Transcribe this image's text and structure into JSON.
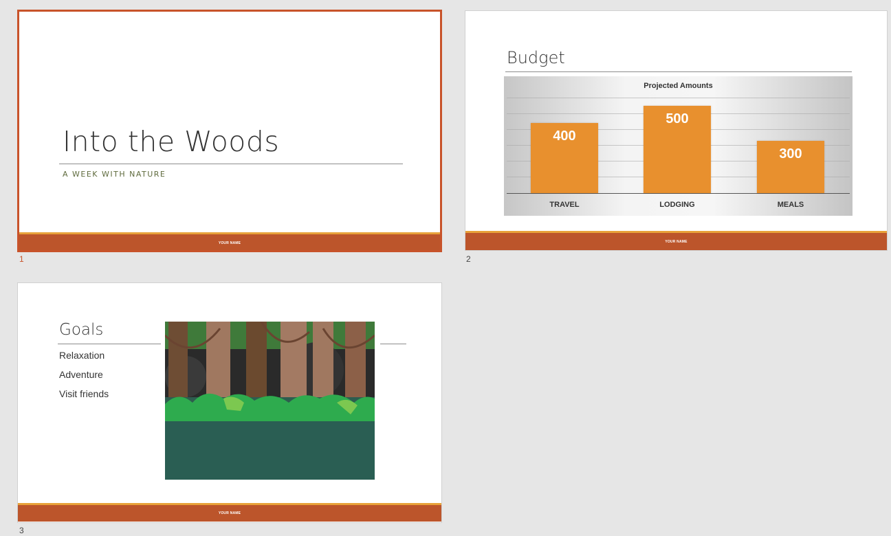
{
  "slides": [
    {
      "number": "1",
      "title": "Into the Woods",
      "subtitle": "A WEEK WITH NATURE",
      "footer": "YOUR NAME"
    },
    {
      "number": "2",
      "title": "Budget",
      "footer": "YOUR NAME"
    },
    {
      "number": "3",
      "title": "Goals",
      "items": [
        "Relaxation",
        "Adventure",
        "Visit friends"
      ],
      "footer": "YOUR NAME"
    }
  ],
  "colors": {
    "accent": "#c8532a",
    "footer": "#bc552b",
    "bar": "#e8902e",
    "forest_ground": "#2b5e52"
  },
  "chart_data": {
    "type": "bar",
    "title": "Projected Amounts",
    "categories": [
      "TRAVEL",
      "LODGING",
      "MEALS"
    ],
    "values": [
      400,
      500,
      300
    ],
    "ylim": [
      0,
      550
    ],
    "grid": true,
    "data_labels": true
  }
}
